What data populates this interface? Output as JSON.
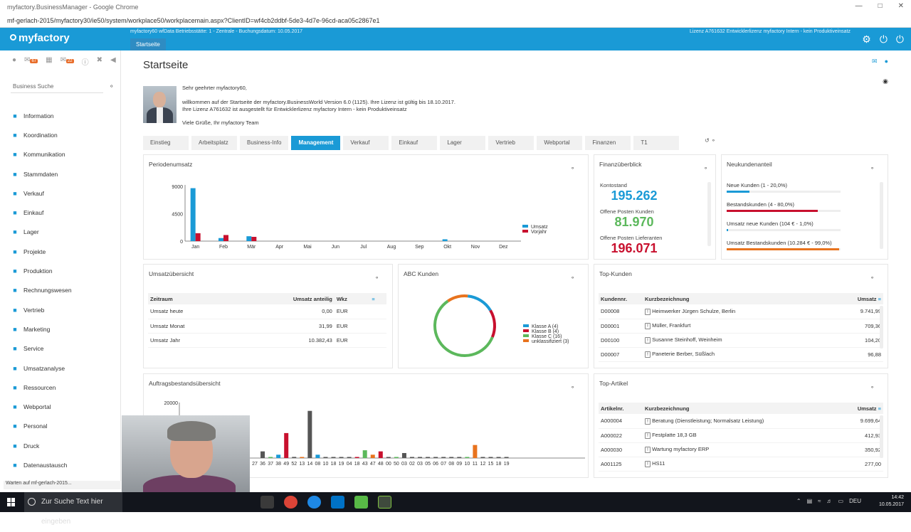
{
  "browser": {
    "title": "myfactory.BusinessManager - Google Chrome",
    "url": "mf-gerlach-2015/myfactory30/ie50/system/workplace50/workplacemain.aspx?ClientID=wf4cb2ddbf-5de3-4d7e-96cd-aca05c2867e1",
    "status": "Warten auf mf-gerlach-2015..."
  },
  "header": {
    "logo": "myfactory",
    "info": "myfactory60 wfData Betriebsstätte: 1 - Zentrale - Buchungsdatum: 10.05.2017",
    "license": "Lizenz A761632 Entwicklerlizenz myfactory Intern - kein Produktiveinsatz",
    "start_tab": "Startseite"
  },
  "sidebar": {
    "badges": [
      "67",
      "22"
    ],
    "search_placeholder": "Business Suche",
    "items": [
      {
        "label": "Information",
        "icon": "info-icon"
      },
      {
        "label": "Koordination",
        "icon": "coordination-icon"
      },
      {
        "label": "Kommunikation",
        "icon": "communication-icon"
      },
      {
        "label": "Stammdaten",
        "icon": "database-icon"
      },
      {
        "label": "Verkauf",
        "icon": "sales-icon"
      },
      {
        "label": "Einkauf",
        "icon": "purchase-icon"
      },
      {
        "label": "Lager",
        "icon": "warehouse-icon"
      },
      {
        "label": "Projekte",
        "icon": "projects-icon"
      },
      {
        "label": "Produktion",
        "icon": "production-icon"
      },
      {
        "label": "Rechnungswesen",
        "icon": "accounting-icon"
      },
      {
        "label": "Vertrieb",
        "icon": "distribution-icon"
      },
      {
        "label": "Marketing",
        "icon": "marketing-icon"
      },
      {
        "label": "Service",
        "icon": "service-icon"
      },
      {
        "label": "Umsatzanalyse",
        "icon": "analysis-icon"
      },
      {
        "label": "Ressourcen",
        "icon": "resources-icon"
      },
      {
        "label": "Webportal",
        "icon": "webportal-icon"
      },
      {
        "label": "Personal",
        "icon": "personnel-icon"
      },
      {
        "label": "Druck",
        "icon": "print-icon"
      },
      {
        "label": "Datenaustausch",
        "icon": "exchange-icon"
      }
    ]
  },
  "main": {
    "title": "Startseite",
    "welcome": {
      "greeting": "Sehr geehrter myfactory60,",
      "line1": "willkommen auf der Startseite der myfactory.BusinessWorld Version 6.0 (1125). Ihre Lizenz ist gültig bis 18.10.2017.",
      "line2": "Ihre Lizenz A761632 ist ausgestellt für Entwicklerlizenz myfactory Intern - kein Produktiveinsatz",
      "signoff": "Viele Grüße, Ihr myfactory Team"
    },
    "tabs": [
      "Einstieg",
      "Arbeitsplatz",
      "Business-Info",
      "Management",
      "Verkauf",
      "Einkauf",
      "Lager",
      "Vertrieb",
      "Webportal",
      "Finanzen",
      "T1"
    ],
    "active_tab": "Management"
  },
  "colors": {
    "accent": "#1a9ad6",
    "red": "#c8102e",
    "green": "#5cb85c",
    "orange": "#e8731e",
    "dark": "#555555"
  },
  "periodenumsatz": {
    "title": "Periodenumsatz",
    "chart_data": {
      "type": "bar",
      "categories": [
        "Jan",
        "Feb",
        "Mär",
        "Apr",
        "Mai",
        "Jun",
        "Jul",
        "Aug",
        "Sep",
        "Okt",
        "Nov",
        "Dez"
      ],
      "series": [
        {
          "name": "Umsatz",
          "values": [
            8700,
            500,
            800,
            0,
            0,
            0,
            0,
            0,
            0,
            300,
            0,
            0
          ]
        },
        {
          "name": "Vorjahr",
          "values": [
            1300,
            1000,
            700,
            0,
            0,
            0,
            0,
            0,
            0,
            0,
            0,
            0
          ]
        }
      ],
      "yticks": [
        "9000",
        "4500",
        "0"
      ],
      "ylim": [
        0,
        9000
      ]
    }
  },
  "finanz": {
    "title": "Finanzüberblick",
    "kontostand_label": "Kontostand",
    "kontostand": "195.262",
    "op_kunden_label": "Offene Posten Kunden",
    "op_kunden": "81.970",
    "op_lief_label": "Offene Posten Lieferanten",
    "op_lief": "196.071"
  },
  "neukunden": {
    "title": "Neukundenanteil",
    "rows": [
      {
        "label": "Neue Kunden (1 - 20,0%)",
        "fraction": 0.2
      },
      {
        "label": "Bestandskunden (4 - 80,0%)",
        "fraction": 0.8
      },
      {
        "label": "Umsatz neue Kunden (104 € - 1,0%)",
        "fraction": 0.01
      },
      {
        "label": "Umsatz Bestandskunden (10.284 € - 99,0%)",
        "fraction": 0.99
      }
    ]
  },
  "umsatzuebersicht": {
    "title": "Umsatzübersicht",
    "headers": {
      "zeitraum": "Zeitraum",
      "anteil": "Umsatz anteilig",
      "wkz": "Wkz"
    },
    "rows": [
      {
        "zeitraum": "Umsatz heute",
        "anteil": "0,00",
        "wkz": "EUR"
      },
      {
        "zeitraum": "Umsatz Monat",
        "anteil": "31,99",
        "wkz": "EUR"
      },
      {
        "zeitraum": "Umsatz Jahr",
        "anteil": "10.382,43",
        "wkz": "EUR"
      }
    ]
  },
  "abc": {
    "title": "ABC Kunden",
    "chart_data": {
      "type": "pie",
      "labels": [
        "Klasse A (4)",
        "Klasse B (4)",
        "Klasse C (16)",
        "unklassifiziert (3)"
      ],
      "values": [
        4,
        4,
        16,
        3
      ]
    }
  },
  "topkunden": {
    "title": "Top-Kunden",
    "headers": {
      "nr": "Kundennr.",
      "bez": "Kurzbezeichnung",
      "umsatz": "Umsatz"
    },
    "rows": [
      {
        "nr": "D00008",
        "bez": "Heimwerker Jürgen Schulze, Berlin",
        "umsatz": "9.741,99"
      },
      {
        "nr": "D00001",
        "bez": "Müller, Frankfurt",
        "umsatz": "709,36"
      },
      {
        "nr": "D00100",
        "bez": "Susanne Steinhoff, Weinheim",
        "umsatz": "104,20"
      },
      {
        "nr": "D00007",
        "bez": "Paneterie Berber, Süßlach",
        "umsatz": "96,88"
      }
    ]
  },
  "auftrag": {
    "title": "Auftragsbestandsübersicht",
    "chart_data": {
      "type": "bar",
      "categories": [
        "27",
        "36",
        "37",
        "38",
        "49",
        "52",
        "13",
        "14",
        "08",
        "10",
        "18",
        "19",
        "04",
        "18",
        "43",
        "47",
        "48",
        "00",
        "50",
        "03",
        "02",
        "03",
        "05",
        "06",
        "07",
        "08",
        "09",
        "10",
        "11",
        "12",
        "15",
        "18",
        "19"
      ],
      "values": [
        0,
        2400,
        300,
        1200,
        9000,
        400,
        300,
        17000,
        1200,
        300,
        300,
        300,
        200,
        300,
        2800,
        1200,
        2400,
        300,
        200,
        1800,
        200,
        200,
        100,
        100,
        100,
        100,
        100,
        300,
        4700,
        300,
        200,
        200,
        200
      ],
      "colors": [
        "#555555",
        "#555555",
        "#5cb85c",
        "#1a9ad6",
        "#c8102e",
        "#555555",
        "#e8731e",
        "#555555",
        "#1a9ad6",
        "#555555",
        "#555555",
        "#555555",
        "#555555",
        "#c8102e",
        "#5cb85c",
        "#e8731e",
        "#c8102e",
        "#555555",
        "#5cb85c",
        "#555555",
        "#555555",
        "#555555",
        "#555555",
        "#555555",
        "#555555",
        "#555555",
        "#555555",
        "#5cb85c",
        "#e8731e",
        "#555555",
        "#555555",
        "#555555",
        "#555555"
      ],
      "yticks": [
        "20000"
      ],
      "ylim": [
        0,
        20000
      ]
    }
  },
  "topartikel": {
    "title": "Top-Artikel",
    "headers": {
      "nr": "Artikelnr.",
      "bez": "Kurzbezeichnung",
      "umsatz": "Umsatz"
    },
    "rows": [
      {
        "nr": "A000004",
        "bez": "Beratung (Dienstleistung; Normalsatz Leistung)",
        "umsatz": "9.699,64"
      },
      {
        "nr": "A000022",
        "bez": "Festplatte 18,3 GB",
        "umsatz": "412,93"
      },
      {
        "nr": "A000030",
        "bez": "Wartung myfactory ERP",
        "umsatz": "350,92"
      },
      {
        "nr": "A001125",
        "bez": "HS11",
        "umsatz": "277,00"
      }
    ]
  },
  "taskbar": {
    "search": "Zur Suche Text hier eingeben",
    "time": "14:42",
    "date": "10.05.2017",
    "lang": "DEU"
  }
}
